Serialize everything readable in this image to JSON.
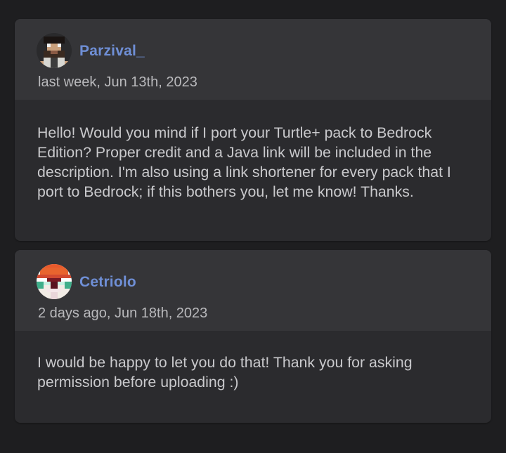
{
  "comments": [
    {
      "author": "Parzival_",
      "timestamp": "last week, Jun 13th, 2023",
      "avatar_icon": "pixel-bearded-man-avatar",
      "text": "Hello! Would you mind if I port your Turtle+ pack to Bedrock Edition? Proper credit and a Java link will be included in the description. I'm also using a link shortener for every pack that I port to Bedrock; if this bothers you, let me know! Thanks."
    },
    {
      "author": "Cetriolo",
      "timestamp": "2 days ago, Jun 18th, 2023",
      "avatar_icon": "pixel-mushroom-avatar",
      "text": "I would be happy to let you do that! Thank you for asking permission before uploading :)"
    }
  ],
  "colors": {
    "background": "#1e1e20",
    "card": "#2b2b2e",
    "card_header": "#353538",
    "username": "#6f8fd6",
    "timestamp": "#b9b9bc",
    "body_text": "#c9c9cc"
  }
}
